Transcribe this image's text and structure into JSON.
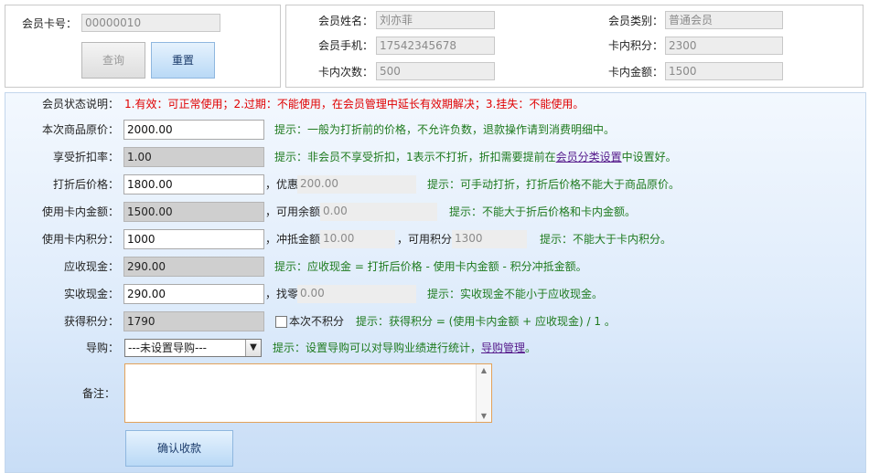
{
  "search": {
    "card_label": "会员卡号：",
    "card_value": "00000010",
    "query_label": "查询",
    "reset_label": "重置"
  },
  "info": {
    "name_label": "会员姓名：",
    "name_value": "刘亦菲",
    "type_label": "会员类别：",
    "type_value": "普通会员",
    "phone_label": "会员手机：",
    "phone_value": "17542345678",
    "points_label": "卡内积分：",
    "points_value": "2300",
    "count_label": "卡内次数：",
    "count_value": "500",
    "balance_label": "卡内金额：",
    "balance_value": "1500"
  },
  "status": {
    "label": "会员状态说明：",
    "text": "1.有效：可正常使用；2.过期：不能使用，在会员管理中延长有效期解决；3.挂失：不能使用。"
  },
  "form": {
    "price_label": "本次商品原价：",
    "price_value": "2000.00",
    "price_hint": "提示：一般为打折前的价格，不允许负数，退款操作请到消费明细中。",
    "discount_label": "享受折扣率：",
    "discount_value": "1.00",
    "discount_hint_a": "提示：非会员不享受折扣，1表示不打折，折扣需要提前在",
    "discount_hint_link": "会员分类设置",
    "discount_hint_b": "中设置好。",
    "after_label": "打折后价格：",
    "after_value": "1800.00",
    "after_off_label": "，优惠",
    "after_off_value": "200.00",
    "after_hint": "提示：可手动打折，打折后价格不能大于商品原价。",
    "card_amt_label": "使用卡内金额：",
    "card_amt_value": "1500.00",
    "card_avail_label": "，可用余额",
    "card_avail_value": "0.00",
    "card_amt_hint": "提示：不能大于折后价格和卡内金额。",
    "card_pts_label": "使用卡内积分：",
    "card_pts_value": "1000",
    "offset_label": "，冲抵金额",
    "offset_value": "10.00",
    "pts_avail_label": "，可用积分",
    "pts_avail_value": "1300",
    "card_pts_hint": "提示：不能大于卡内积分。",
    "due_label": "应收现金：",
    "due_value": "290.00",
    "due_hint": "提示：应收现金 = 打折后价格 - 使用卡内金额 - 积分冲抵金额。",
    "paid_label": "实收现金：",
    "paid_value": "290.00",
    "change_label": "，找零",
    "change_value": "0.00",
    "paid_hint": "提示：实收现金不能小于应收现金。",
    "earn_label": "获得积分：",
    "earn_value": "1790",
    "no_points_label": "本次不积分",
    "earn_hint": "提示：获得积分 = (使用卡内金额 + 应收现金) / 1 。",
    "guide_label": "导购：",
    "guide_value": "---未设置导购---",
    "guide_hint": "提示：设置导购可以对导购业绩进行统计，",
    "guide_link": "导购管理",
    "guide_hint_end": "。",
    "note_label": "备注：",
    "note_value": "",
    "confirm_label": "确认收款"
  }
}
